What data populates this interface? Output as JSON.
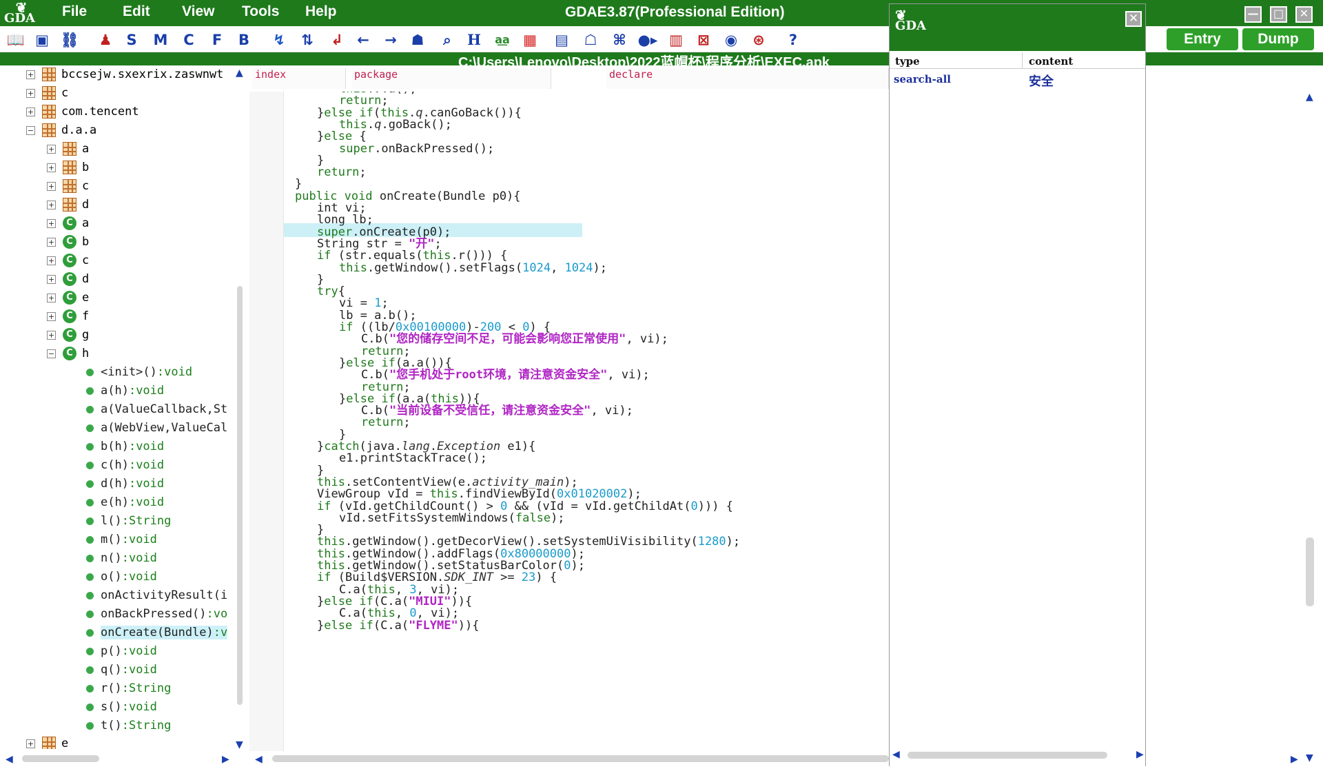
{
  "app": {
    "title": "GDAE3.87(Professional Edition)",
    "logo_text": "GDA",
    "path": "C:\\Users\\Lenovo\\Desktop\\2022蓝帽杯\\程序分析\\EXEC.apk",
    "menu": [
      "File",
      "Edit",
      "View",
      "Tools",
      "Help"
    ],
    "entry_label": "Entry",
    "dump_label": "Dump",
    "minimize": "—",
    "maximize": "□",
    "close": "✕",
    "colors": {
      "titlebar": "#1f7a1c",
      "button": "#2ea02a",
      "keyword": "#1f7a1c",
      "string": "#b025c4",
      "number": "#1a9acb"
    }
  },
  "toolbar": {
    "icons": [
      "book-icon",
      "save-icon",
      "link-icon",
      "person-icon",
      "S",
      "M",
      "C",
      "F",
      "B",
      "jump-icon",
      "branch-icon",
      "return-icon",
      "back-arrow-icon",
      "forward-arrow-icon",
      "android-bug-icon",
      "search-doc-icon",
      "H",
      "text-search-icon",
      "color-grid-icon",
      "xml-icon",
      "android-icon",
      "command-icon",
      "toggle-icon",
      "grid-icon",
      "crossed-icon",
      "eye-icon",
      "fingerprint-icon",
      "help-icon"
    ],
    "S": "S",
    "M": "M",
    "C": "C",
    "F": "F",
    "B": "B",
    "H": "H",
    "help": "?"
  },
  "tree": {
    "items": [
      {
        "label": "bccsejw.sxexrix.zaswnwt",
        "icon": "package-icon",
        "expander": "+"
      },
      {
        "label": "c",
        "icon": "package-icon",
        "expander": "+"
      },
      {
        "label": "com.tencent",
        "icon": "package-icon",
        "expander": "+"
      },
      {
        "label": "d.a.a",
        "icon": "package-icon",
        "expander": "−"
      },
      {
        "label": "a",
        "icon": "package-icon",
        "expander": "+"
      },
      {
        "label": "b",
        "icon": "package-icon",
        "expander": "+"
      },
      {
        "label": "c",
        "icon": "package-icon",
        "expander": "+"
      },
      {
        "label": "d",
        "icon": "package-icon",
        "expander": "+"
      },
      {
        "label": "a",
        "icon": "class-icon",
        "expander": "+"
      },
      {
        "label": "b",
        "icon": "class-icon",
        "expander": "+"
      },
      {
        "label": "c",
        "icon": "class-icon",
        "expander": "+"
      },
      {
        "label": "d",
        "icon": "class-icon",
        "expander": "+"
      },
      {
        "label": "e",
        "icon": "class-icon",
        "expander": "+"
      },
      {
        "label": "f",
        "icon": "class-icon",
        "expander": "+"
      },
      {
        "label": "g",
        "icon": "class-icon",
        "expander": "+"
      },
      {
        "label": "h",
        "icon": "class-icon",
        "expander": "−"
      }
    ],
    "methods": [
      {
        "name": "<init>()",
        "type": ":void"
      },
      {
        "name": "a(h)",
        "type": ":void"
      },
      {
        "name": "a(ValueCallback,St",
        "type": ""
      },
      {
        "name": "a(WebView,ValueCal",
        "type": ""
      },
      {
        "name": "b(h)",
        "type": ":void"
      },
      {
        "name": "c(h)",
        "type": ":void"
      },
      {
        "name": "d(h)",
        "type": ":void"
      },
      {
        "name": "e(h)",
        "type": ":void"
      },
      {
        "name": "l()",
        "type": ":String"
      },
      {
        "name": "m()",
        "type": ":void"
      },
      {
        "name": "n()",
        "type": ":void"
      },
      {
        "name": "o()",
        "type": ":void"
      },
      {
        "name": "onActivityResult(i",
        "type": ""
      },
      {
        "name": "onBackPressed()",
        "type": ":vo"
      },
      {
        "name": "onCreate(Bundle)",
        "type": ":v"
      },
      {
        "name": "p()",
        "type": ":void"
      },
      {
        "name": "q()",
        "type": ":void"
      },
      {
        "name": "r()",
        "type": ":String"
      },
      {
        "name": "s()",
        "type": ":void"
      },
      {
        "name": "t()",
        "type": ":String"
      }
    ],
    "last_item": "e"
  },
  "code_header": {
    "index": "index",
    "package": "package",
    "declare": "declare"
  },
  "code": [
    [
      [
        "",
        0
      ],
      [
        "this",
        1
      ],
      [
        ".",
        0
      ],
      [
        "v",
        3
      ],
      [
        ".a();",
        0
      ]
    ],
    [
      [
        "",
        0
      ],
      [
        "return",
        1
      ],
      [
        ";",
        0
      ]
    ],
    [
      [
        "}",
        0
      ],
      [
        "else if",
        1
      ],
      [
        "(",
        0
      ],
      [
        "this",
        1
      ],
      [
        ".",
        0
      ],
      [
        "q",
        3
      ],
      [
        ".canGoBack()){",
        0
      ]
    ],
    [
      [
        "",
        0
      ],
      [
        "this",
        1
      ],
      [
        ".",
        0
      ],
      [
        "q",
        3
      ],
      [
        ".goBack();",
        0
      ]
    ],
    [
      [
        "}",
        0
      ],
      [
        "else",
        1
      ],
      [
        " {",
        0
      ]
    ],
    [
      [
        "",
        0
      ],
      [
        "super",
        1
      ],
      [
        ".onBackPressed();",
        0
      ]
    ],
    [
      [
        "}",
        0
      ]
    ],
    [
      [
        "return",
        1
      ],
      [
        ";",
        0
      ]
    ],
    [
      [
        "}",
        0
      ]
    ],
    [
      [
        "public void",
        1
      ],
      [
        " onCreate(Bundle p0){",
        0
      ]
    ],
    [
      [
        "int vi;",
        0
      ]
    ],
    [
      [
        "long lb;",
        0
      ]
    ],
    [
      [
        "super",
        1
      ],
      [
        ".onCreate(p0);",
        0
      ]
    ],
    [
      [
        "String str = ",
        0
      ],
      [
        "\"开\"",
        2
      ],
      [
        ";",
        0
      ]
    ],
    [
      [
        "if",
        1
      ],
      [
        " (str.equals(",
        0
      ],
      [
        "this",
        1
      ],
      [
        ".r())) {",
        0
      ]
    ],
    [
      [
        "",
        0
      ],
      [
        "this",
        1
      ],
      [
        ".getWindow().setFlags(",
        0
      ],
      [
        "1024",
        4
      ],
      [
        ", ",
        0
      ],
      [
        "1024",
        4
      ],
      [
        ");",
        0
      ]
    ],
    [
      [
        "}",
        0
      ]
    ],
    [
      [
        "try",
        1
      ],
      [
        "{",
        0
      ]
    ],
    [
      [
        "vi = ",
        0
      ],
      [
        "1",
        4
      ],
      [
        ";",
        0
      ]
    ],
    [
      [
        "lb = a.b();",
        0
      ]
    ],
    [
      [
        "if",
        1
      ],
      [
        " ((lb/",
        0
      ],
      [
        "0x00100000",
        4
      ],
      [
        ")-",
        0
      ],
      [
        "200",
        4
      ],
      [
        " < ",
        0
      ],
      [
        "0",
        4
      ],
      [
        ") {",
        0
      ]
    ],
    [
      [
        "C.b(",
        0
      ],
      [
        "\"您的储存空间不足，可能会影响您正常使用\"",
        2
      ],
      [
        ", vi);",
        0
      ]
    ],
    [
      [
        "return",
        1
      ],
      [
        ";",
        0
      ]
    ],
    [
      [
        "}",
        0
      ],
      [
        "else if",
        1
      ],
      [
        "(a.a()){",
        0
      ]
    ],
    [
      [
        "C.b(",
        0
      ],
      [
        "\"您手机处于root环境，请注意资金安全\"",
        2
      ],
      [
        ", vi);",
        0
      ]
    ],
    [
      [
        "return",
        1
      ],
      [
        ";",
        0
      ]
    ],
    [
      [
        "}",
        0
      ],
      [
        "else if",
        1
      ],
      [
        "(a.a(",
        0
      ],
      [
        "this",
        1
      ],
      [
        ")){",
        0
      ]
    ],
    [
      [
        "C.b(",
        0
      ],
      [
        "\"当前设备不受信任，请注意资金安全\"",
        2
      ],
      [
        ", vi);",
        0
      ]
    ],
    [
      [
        "return",
        1
      ],
      [
        ";",
        0
      ]
    ],
    [
      [
        "}",
        0
      ]
    ],
    [
      [
        "}",
        0
      ],
      [
        "catch",
        1
      ],
      [
        "(java.",
        0
      ],
      [
        "lang",
        3
      ],
      [
        ".",
        0
      ],
      [
        "Exception",
        3
      ],
      [
        " e1){",
        0
      ]
    ],
    [
      [
        "e1.printStackTrace();",
        0
      ]
    ],
    [
      [
        "}",
        0
      ]
    ],
    [
      [
        "this",
        1
      ],
      [
        ".setContentView(e.",
        0
      ],
      [
        "activity_main",
        3
      ],
      [
        ");",
        0
      ]
    ],
    [
      [
        "ViewGroup vId = ",
        0
      ],
      [
        "this",
        1
      ],
      [
        ".findViewById(",
        0
      ],
      [
        "0x01020002",
        4
      ],
      [
        ");",
        0
      ]
    ],
    [
      [
        "if",
        1
      ],
      [
        " (vId.getChildCount() > ",
        0
      ],
      [
        "0",
        4
      ],
      [
        " && (vId = vId.getChildAt(",
        0
      ],
      [
        "0",
        4
      ],
      [
        "))) {",
        0
      ]
    ],
    [
      [
        "vId.setFitsSystemWindows(",
        0
      ],
      [
        "false",
        1
      ],
      [
        ");",
        0
      ]
    ],
    [
      [
        "}",
        0
      ]
    ],
    [
      [
        "this",
        1
      ],
      [
        ".getWindow().getDecorView().setSystemUiVisibility(",
        0
      ],
      [
        "1280",
        4
      ],
      [
        ");",
        0
      ]
    ],
    [
      [
        "this",
        1
      ],
      [
        ".getWindow().addFlags(",
        0
      ],
      [
        "0x80000000",
        4
      ],
      [
        ");",
        0
      ]
    ],
    [
      [
        "this",
        1
      ],
      [
        ".getWindow().setStatusBarColor(",
        0
      ],
      [
        "0",
        4
      ],
      [
        ");",
        0
      ]
    ],
    [
      [
        "if",
        1
      ],
      [
        " (Build$VERSION.",
        0
      ],
      [
        "SDK_INT",
        3
      ],
      [
        " >= ",
        0
      ],
      [
        "23",
        4
      ],
      [
        ") {",
        0
      ]
    ],
    [
      [
        "C.a(",
        0
      ],
      [
        "this",
        1
      ],
      [
        ", ",
        0
      ],
      [
        "3",
        4
      ],
      [
        ", vi);",
        0
      ]
    ],
    [
      [
        "}",
        0
      ],
      [
        "else if",
        1
      ],
      [
        "(C.a(",
        0
      ],
      [
        "\"MIUI\"",
        2
      ],
      [
        ")){",
        0
      ]
    ],
    [
      [
        "C.a(",
        0
      ],
      [
        "this",
        1
      ],
      [
        ", ",
        0
      ],
      [
        "0",
        4
      ],
      [
        ", vi);",
        0
      ]
    ],
    [
      [
        "}",
        0
      ],
      [
        "else if",
        1
      ],
      [
        "(C.a(",
        0
      ],
      [
        "\"FLYME\"",
        2
      ],
      [
        ")){",
        0
      ]
    ]
  ],
  "search_dialog": {
    "logo_text": "GDA",
    "close": "✕",
    "col_type": "type",
    "col_content": "content",
    "row_type": "search-all",
    "row_content": "安全"
  }
}
